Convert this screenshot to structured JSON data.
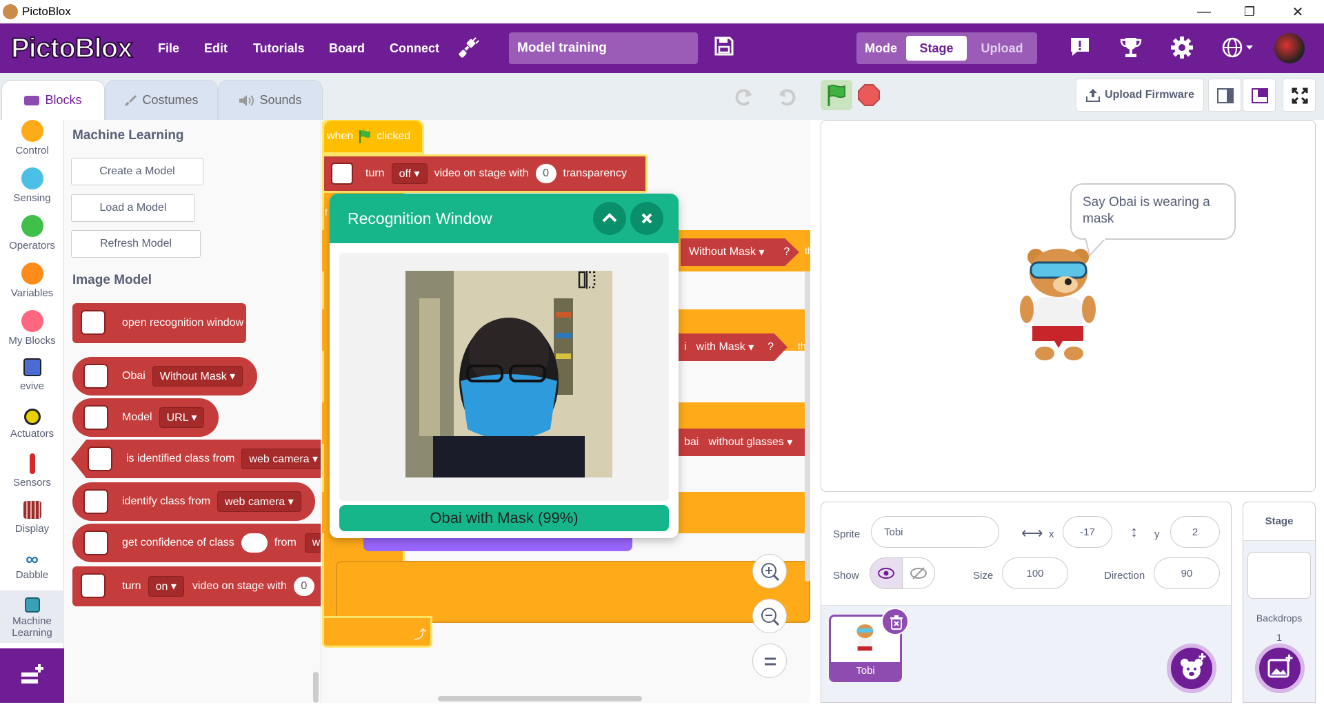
{
  "window": {
    "title": "PictoBlox",
    "minimize": "—",
    "restore": "❐",
    "close": "✕"
  },
  "menubar": {
    "logo": "PictoBlox",
    "items": [
      "File",
      "Edit",
      "Tutorials",
      "Board",
      "Connect"
    ],
    "project_name": "Model training",
    "mode_label": "Mode",
    "mode_options": [
      "Stage",
      "Upload"
    ],
    "mode_selected": "Stage"
  },
  "tabs": [
    "Blocks",
    "Costumes",
    "Sounds"
  ],
  "categories": [
    {
      "label": "Control",
      "color": "#ffab19"
    },
    {
      "label": "Sensing",
      "color": "#4cbfe6"
    },
    {
      "label": "Operators",
      "color": "#40bf4a"
    },
    {
      "label": "Variables",
      "color": "#ff8c1a"
    },
    {
      "label": "My Blocks",
      "color": "#ff6680"
    },
    {
      "label": "evive",
      "color": "#4a6cd4"
    },
    {
      "label": "Actuators",
      "color": "#e8d100"
    },
    {
      "label": "Sensors",
      "color": "#d62828"
    },
    {
      "label": "Display",
      "color": "#9b2d2d"
    },
    {
      "label": "Dabble",
      "color": "#1e73be"
    },
    {
      "label": "Machine Learning",
      "color": "#3aa0b8"
    }
  ],
  "palette": {
    "section_ml": "Machine Learning",
    "buttons": [
      "Create a Model",
      "Load a Model",
      "Refresh Model"
    ],
    "section_image": "Image Model",
    "blocks": {
      "open_window": "open recognition window",
      "obai": "Obai",
      "obai_dd": "Without Mask",
      "model": "Model",
      "model_dd": "URL",
      "is_identified": "is identified class from",
      "is_identified_dd": "web camera",
      "identify": "identify class from",
      "identify_dd": "web camera",
      "confidence": "get confidence of class",
      "confidence_from": "from",
      "confidence_dd": "we",
      "turn": "turn",
      "turn_dd": "on",
      "video_text": "video on stage with",
      "video_val": "0"
    }
  },
  "scripts": {
    "hat_when": "when",
    "hat_clicked": "clicked",
    "turn": "turn",
    "turn_dd": "off",
    "video_text": "video on stage with",
    "video_val": "0",
    "transparency": "transparency",
    "without_mask": "Without Mask",
    "with_mask": "with Mask",
    "bai": "bai",
    "without_glasses": "without glasses",
    "q": "?",
    "th": "th",
    "i": "i",
    "f": "f"
  },
  "recognition": {
    "title": "Recognition Window",
    "result": "Obai with Mask (99%)"
  },
  "stage": {
    "upload_firmware": "Upload Firmware",
    "speech": "Say Obai is wearing a mask"
  },
  "sprite": {
    "sprite_label": "Sprite",
    "name": "Tobi",
    "x_label": "x",
    "x": "-17",
    "y_label": "y",
    "y": "2",
    "show_label": "Show",
    "size_label": "Size",
    "size": "100",
    "direction_label": "Direction",
    "direction": "90",
    "thumb_name": "Tobi"
  },
  "stage_panel": {
    "title": "Stage",
    "backdrops_label": "Backdrops",
    "backdrops_count": "1"
  },
  "colors": {
    "brand": "#6f1d94",
    "block_red": "#c53c3c",
    "event_yellow": "#ffbf00",
    "control_orange": "#ffab19",
    "recognition_green": "#17b68a"
  }
}
